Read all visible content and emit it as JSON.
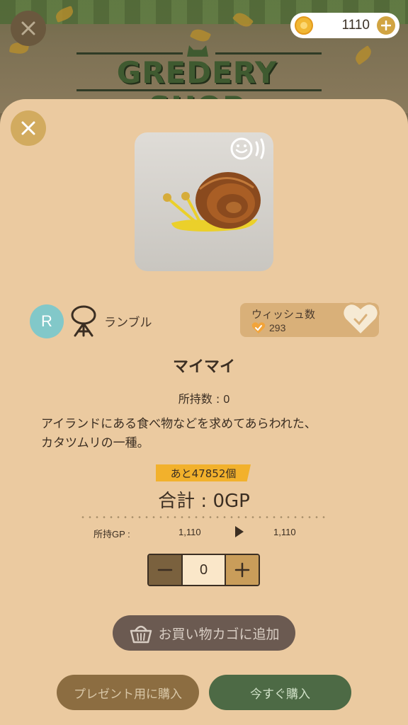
{
  "header": {
    "shop_title": "GREDERY SHOP",
    "gp_balance": "1110",
    "icons": {
      "close": "close-icon",
      "coin": "coin-icon",
      "add": "plus-icon"
    }
  },
  "item": {
    "rarity": "R",
    "motion_type": "ランブル",
    "name": "マイマイ",
    "owned_label": "所持数 : ",
    "owned_count": "0",
    "description_line1": "アイランドにある食べ物などを求めてあらわれた、",
    "description_line2": "カタツムリの一種。",
    "icons": {
      "emote": "emote-sound-icon",
      "motion": "rumble-motion-icon"
    }
  },
  "wishlist": {
    "label": "ウィッシュ数",
    "count": "293",
    "icons": {
      "count": "heart-check-icon",
      "button": "heart-check-button-icon"
    }
  },
  "purchase": {
    "remaining": "あと47852個",
    "total": "合計 : 0GP",
    "gp_label": "所持GP :",
    "gp_before": "1,110",
    "gp_after": "1,110",
    "quantity": "0",
    "add_to_cart": "お買い物カゴに追加",
    "buy_as_gift": "プレゼント用に購入",
    "buy_now": "今すぐ購入"
  },
  "colors": {
    "panel": "#ebcaa0",
    "accent_gold": "#f2b12c",
    "rarity_teal": "#82c8c9",
    "buy_green": "#4d6a45",
    "gift_brown": "#8c6d41"
  }
}
